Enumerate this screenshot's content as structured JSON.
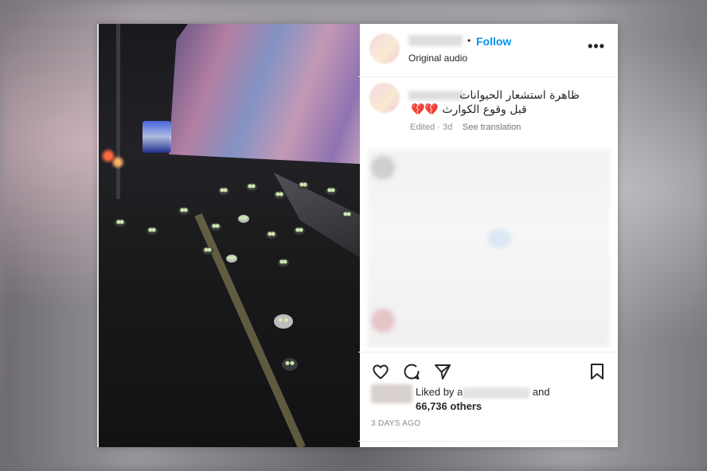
{
  "post": {
    "header": {
      "dot": "•",
      "follow_label": "Follow",
      "audio_label": "Original audio",
      "more_icon": "more-options-icon",
      "more_glyph": "•••"
    },
    "caption": {
      "line1": "ظاهرة استشعار الحيوانات",
      "line2": "قبل وقوع الكوارث",
      "hearts": "💔💔",
      "edited": "Edited · 3d",
      "see_translation": "See translation"
    },
    "actions": {
      "like_icon": "heart-icon",
      "comment_icon": "comment-icon",
      "share_icon": "send-icon",
      "save_icon": "bookmark-icon"
    },
    "likes": {
      "liked_by": "Liked by",
      "prefix_letter": "a",
      "and": "and",
      "others": "66,736 others"
    },
    "time_ago": "3 DAYS AGO",
    "colors": {
      "follow": "#0095f6",
      "text": "#262626",
      "muted": "#8e8e8e",
      "heart": "#b3122a"
    }
  }
}
